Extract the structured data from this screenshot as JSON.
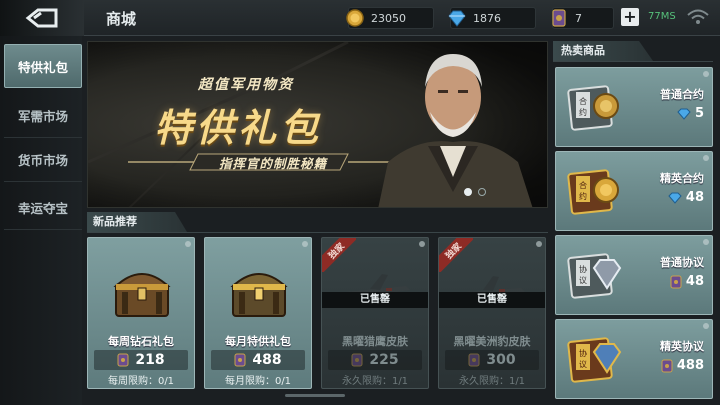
{
  "header": {
    "title": "商城",
    "gold": "23050",
    "diamonds": "1876",
    "tickets": "7",
    "add_label": "+",
    "latency": "77MS"
  },
  "sidebar": {
    "items": [
      {
        "label": "特供礼包",
        "active": true
      },
      {
        "label": "军需市场",
        "active": false
      },
      {
        "label": "货币市场",
        "active": false
      },
      {
        "label": "幸运夺宝",
        "active": false
      }
    ]
  },
  "banner": {
    "subtitle": "超值军用物资",
    "title": "特供礼包",
    "ribbon": "指挥官的制胜秘籍",
    "page_count": 2,
    "page_active": 1
  },
  "new_items": {
    "header": "新品推荐",
    "cards": [
      {
        "name": "每周钻石礼包",
        "price": "218",
        "limit": "每周限购：0/1",
        "sold": false,
        "sold_label": "",
        "tag": ""
      },
      {
        "name": "每月特供礼包",
        "price": "488",
        "limit": "每月限购：0/1",
        "sold": false,
        "sold_label": "",
        "tag": ""
      },
      {
        "name": "黑曜猎鹰皮肤",
        "price": "225",
        "limit": "永久限购：1/1",
        "sold": true,
        "sold_label": "已售罄",
        "tag": "独家"
      },
      {
        "name": "黑曜美洲豹皮肤",
        "price": "300",
        "limit": "永久限购：1/1",
        "sold": true,
        "sold_label": "已售罄",
        "tag": "独家"
      }
    ]
  },
  "hot_items": {
    "header": "热卖商品",
    "items": [
      {
        "name": "普通合约",
        "price": "5",
        "currency": "diamond",
        "icon": "ordinary-contract-icon"
      },
      {
        "name": "精英合约",
        "price": "48",
        "currency": "diamond",
        "icon": "elite-contract-icon"
      },
      {
        "name": "普通协议",
        "price": "48",
        "currency": "ticket",
        "icon": "ordinary-protocol-icon"
      },
      {
        "name": "精英协议",
        "price": "488",
        "currency": "ticket",
        "icon": "elite-protocol-icon"
      }
    ]
  },
  "colors": {
    "accent_card": "#7f9fa0",
    "gold_text": "#f7d98a",
    "latency_green": "#56c07a",
    "sold_tag": "#8e2b25"
  }
}
